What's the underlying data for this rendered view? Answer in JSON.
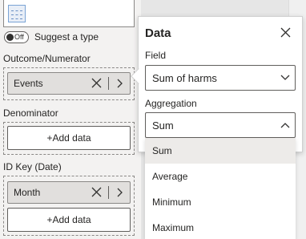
{
  "left_pane": {
    "suggest_toggle": {
      "state_text": "Off",
      "label": "Suggest a type"
    },
    "outcome": {
      "label": "Outcome/Numerator",
      "field": "Events"
    },
    "denominator": {
      "label": "Denominator",
      "add_label": "+Add data"
    },
    "id_key": {
      "label": "ID Key (Date)",
      "field": "Month",
      "add_label": "+Add data"
    }
  },
  "panel": {
    "title": "Data",
    "field_label": "Field",
    "field_value": "Sum of harms",
    "aggregation_label": "Aggregation",
    "aggregation_value": "Sum",
    "aggregation_options": [
      "Sum",
      "Average",
      "Minimum",
      "Maximum"
    ],
    "selected_option": "Sum"
  },
  "icons": {
    "close": "close-icon",
    "remove": "x-icon",
    "expand": "chevron-right-icon",
    "dropdown_closed": "chevron-down-icon",
    "dropdown_open": "chevron-up-icon"
  },
  "colors": {
    "pane_background": "#f3f2f1",
    "pill_background": "#e1dfdd",
    "selected_option_background": "#edebe9",
    "border": "#605e5c"
  }
}
